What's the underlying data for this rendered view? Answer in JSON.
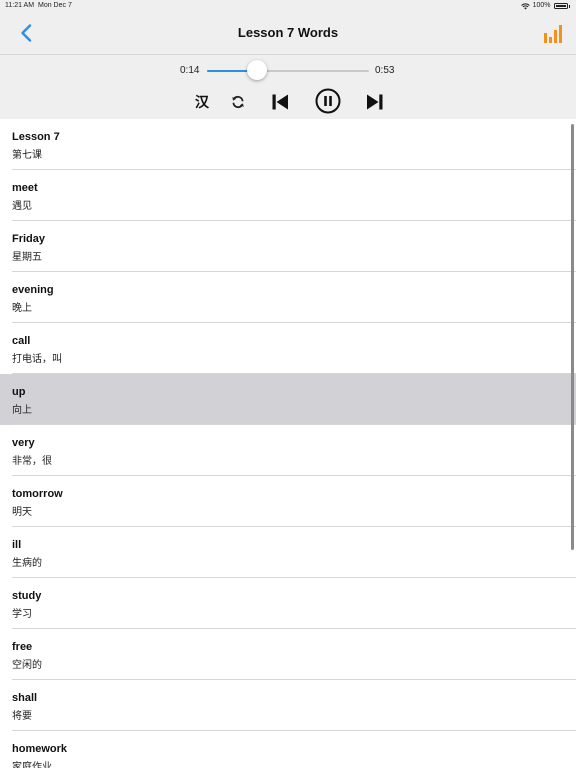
{
  "status_bar": {
    "time": "11:21 AM",
    "date": "Mon Dec 7",
    "battery": "100%"
  },
  "nav": {
    "title": "Lesson 7 Words",
    "back_icon": "chevron-left-icon",
    "stats_icon": "bar-chart-icon",
    "accent_color": "#2b8fe6",
    "stats_color": "#f2921d"
  },
  "player": {
    "elapsed": "0:14",
    "total": "0:53",
    "progress": 0.31,
    "han_label": "汉",
    "repeat_icon": "repeat-icon",
    "prev_icon": "skip-previous-icon",
    "pause_icon": "pause-icon",
    "next_icon": "skip-next-icon"
  },
  "words": [
    {
      "en": "Lesson 7",
      "zh": "第七课"
    },
    {
      "en": "meet",
      "zh": "遇见"
    },
    {
      "en": "Friday",
      "zh": "星期五"
    },
    {
      "en": "evening",
      "zh": "晚上"
    },
    {
      "en": "call",
      "zh": "打电话，叫"
    },
    {
      "en": "up",
      "zh": "向上"
    },
    {
      "en": "very",
      "zh": "非常，很"
    },
    {
      "en": "tomorrow",
      "zh": "明天"
    },
    {
      "en": "ill",
      "zh": "生病的"
    },
    {
      "en": "study",
      "zh": "学习"
    },
    {
      "en": "free",
      "zh": "空闲的"
    },
    {
      "en": "shall",
      "zh": "将要"
    },
    {
      "en": "homework",
      "zh": "家庭作业"
    }
  ],
  "selected_index": 5
}
